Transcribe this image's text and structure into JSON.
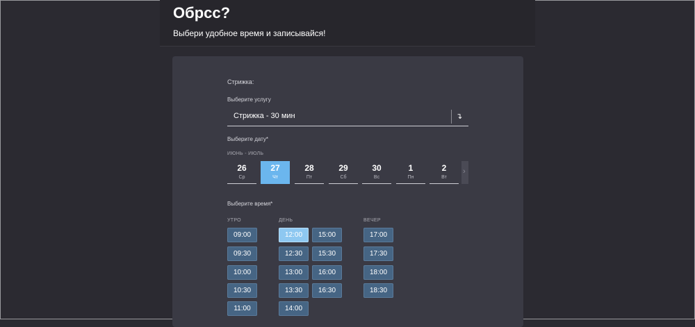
{
  "page": {
    "title": "Обрсс?",
    "subtitle": "Выбери удобное время и записывайся!"
  },
  "form": {
    "section_label": "Стрижка:",
    "service_label": "Выберите услугу",
    "service_value": "Стрижка - 30 мин",
    "select_icon": "↴",
    "date_label": "Выберите дату*",
    "month_range": "ИЮНЬ - ИЮЛЬ",
    "dates": [
      {
        "num": "26",
        "dow": "Ср"
      },
      {
        "num": "27",
        "dow": "Чт"
      },
      {
        "num": "28",
        "dow": "Пт"
      },
      {
        "num": "29",
        "dow": "Сб"
      },
      {
        "num": "30",
        "dow": "Вс"
      },
      {
        "num": "1",
        "dow": "Пн"
      },
      {
        "num": "2",
        "dow": "Вт"
      }
    ],
    "selected_date": "27",
    "next_icon": "›",
    "time_label": "Выберите время*",
    "periods": {
      "morning": "УТРО",
      "day": "ДЕНЬ",
      "evening": "ВЕЧЕР"
    },
    "morning_slots": [
      "09:00",
      "09:30",
      "10:00",
      "10:30",
      "11:00"
    ],
    "day_slots_col1": [
      "12:00",
      "12:30",
      "13:00",
      "13:30",
      "14:00"
    ],
    "day_slots_col2": [
      "15:00",
      "15:30",
      "16:00",
      "16:30"
    ],
    "evening_slots": [
      "17:00",
      "17:30",
      "18:00",
      "18:30"
    ],
    "selected_time": "12:00"
  },
  "colors": {
    "background": "#2b2a31",
    "card": "#3a3a44",
    "accent": "#6bb6ee",
    "slot": "#466584"
  }
}
